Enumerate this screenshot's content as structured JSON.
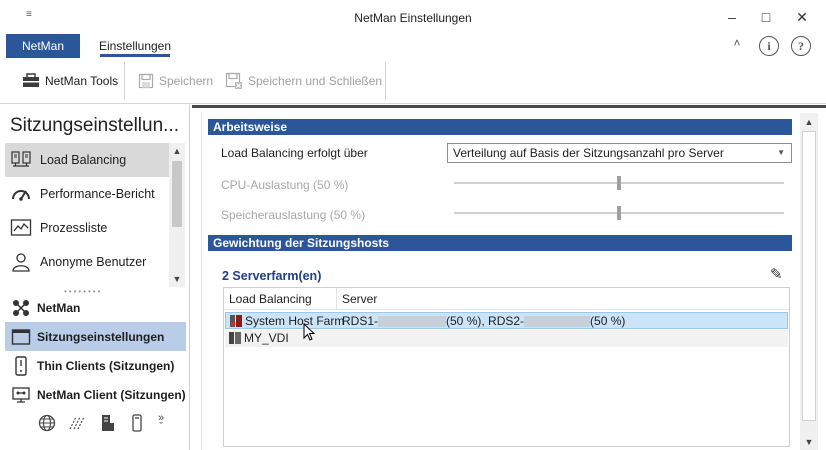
{
  "window": {
    "title": "NetMan Einstellungen",
    "quick_access": "≡",
    "minimize": "–",
    "maximize": "□",
    "close": "✕"
  },
  "ribbon": {
    "file_tab": "NetMan",
    "active_tab": "Einstellungen",
    "collapse": "˄",
    "info": "i",
    "help": "?"
  },
  "toolbar": {
    "tools_label": "NetMan Tools",
    "save_label": "Speichern",
    "save_close_label": "Speichern und Schließen"
  },
  "leftnav": {
    "heading": "Sitzungseinstellun...",
    "items": [
      {
        "label": "Load Balancing",
        "icon": "load-balancing-icon",
        "selected": true
      },
      {
        "label": "Performance-Bericht",
        "icon": "speedometer-icon"
      },
      {
        "label": "Prozessliste",
        "icon": "chart-icon"
      },
      {
        "label": "Anonyme Benutzer",
        "icon": "user-icon"
      }
    ],
    "categories": [
      {
        "label": "NetMan",
        "icon": "netman-icon"
      },
      {
        "label": "Sitzungseinstellungen",
        "icon": "window-icon",
        "selected": true
      },
      {
        "label": "Thin Clients (Sitzungen)",
        "icon": "thin-client-icon"
      },
      {
        "label": "NetMan Client (Sitzungen)",
        "icon": "network-icon"
      }
    ]
  },
  "main": {
    "section1": "Arbeitsweise",
    "lb_label": "Load Balancing erfolgt über",
    "lb_value": "Verteilung auf Basis der Sitzungsanzahl pro Server",
    "cpu_label": "CPU-Auslastung (50 %)",
    "cpu_level": 0.5,
    "mem_label": "Speicherauslastung (50 %)",
    "mem_level": 0.5,
    "section2": "Gewichtung der Sitzungshosts",
    "farm_count": "2 Serverfarm(en)",
    "table": {
      "col1": "Load Balancing",
      "col2": "Server",
      "rows": [
        {
          "name": "System Host Farm",
          "srv1": "RDS1-",
          "pct1": "(50 %), RDS2-",
          "pct2": "(50 %)"
        },
        {
          "name": "MY_VDI",
          "srv1": "",
          "pct1": "",
          "pct2": ""
        }
      ]
    }
  },
  "colors": {
    "accent": "#2b579a",
    "selection": "#cce4f7",
    "nav_selected": "#b9cde8"
  }
}
